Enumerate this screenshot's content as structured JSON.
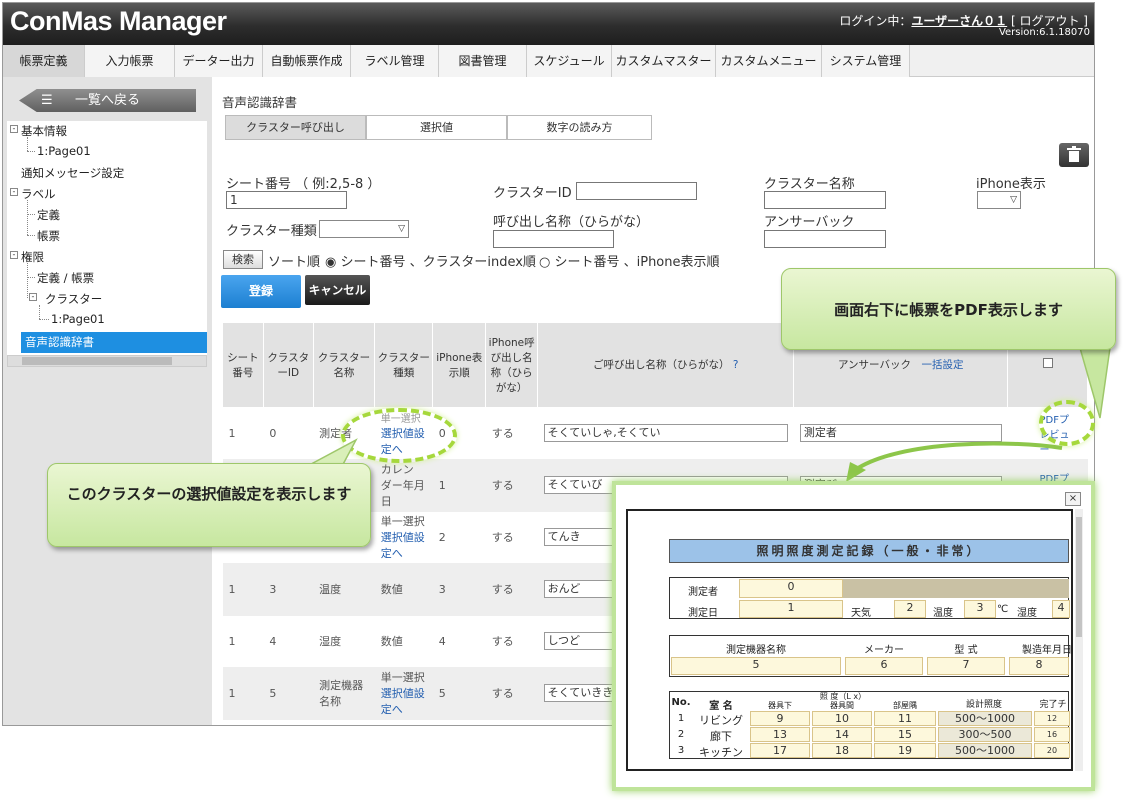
{
  "header": {
    "logo": "ConMas Manager",
    "login_label": "ログイン中：",
    "user": "ユーザーさん０１",
    "logout": "[ ログアウト ]",
    "version": "Version:6.1.18070"
  },
  "nav": {
    "items": [
      "帳票定義",
      "入力帳票",
      "データー出力",
      "自動帳票作成",
      "ラベル管理",
      "図書管理",
      "スケジュール",
      "カスタムマスター",
      "カスタムメニュー",
      "システム管理"
    ]
  },
  "sidebar": {
    "back_label": "一覧へ戻る",
    "tree": [
      "基本情報",
      "1:Page01",
      "通知メッセージ設定",
      "ラベル",
      "定義",
      "帳票",
      "権限",
      "定義 / 帳票",
      "クラスター",
      "1:Page01",
      "音声認識辞書"
    ]
  },
  "main": {
    "title": "音声認識辞書",
    "tabs": [
      "クラスター呼び出し",
      "選択値",
      "数字の読み方"
    ],
    "form": {
      "sheet_label": "シート番号 （ 例:2,5-8 ）",
      "sheet_value": "1",
      "cluster_id_label": "クラスターID",
      "cluster_name_label": "クラスター名称",
      "iphone_label": "iPhone表示",
      "cluster_type_label": "クラスター種類",
      "reading_label": "呼び出し名称（ひらがな）",
      "answer_label": "アンサーバック",
      "search_button": "検索",
      "sort_label": "ソート順",
      "sort_opt1": "シート番号 、クラスターindex順",
      "sort_opt2": "シート番号 、iPhone表示順",
      "register_button": "登録",
      "cancel_button": "キャンセル"
    },
    "table": {
      "headers": [
        "シート番号",
        "クラスターID",
        "クラスター名称",
        "クラスター種類",
        "iPhone表示順",
        "iPhone呼び出し名称（ひらがな）",
        "ご呼び出し名称（ひらがな）",
        "アンサーバック"
      ],
      "help": "?",
      "batch": "一括設定",
      "rows": [
        {
          "sheet": "1",
          "id": "0",
          "name": "測定者",
          "type1": "単一選択",
          "type2": "選択値設定へ",
          "order": "0",
          "yomi": "する",
          "reading": "そくていしゃ,そくてい",
          "answer": "測定者",
          "pdf": "PDFプレビュー"
        },
        {
          "sheet": "",
          "id": "",
          "name": "",
          "type1": "カレン",
          "type2": "ダー年月日",
          "order": "1",
          "yomi": "する",
          "reading": "そくていび",
          "answer": "測定び",
          "pdf": "PDFプレ"
        },
        {
          "sheet": "",
          "id": "",
          "name": "",
          "type1": "単一選択",
          "type2": "選択値設定へ",
          "order": "2",
          "yomi": "する",
          "reading": "てんき",
          "answer": "",
          "pdf": ""
        },
        {
          "sheet": "1",
          "id": "3",
          "name": "温度",
          "type1": "数値",
          "type2": "",
          "order": "3",
          "yomi": "する",
          "reading": "おんど",
          "answer": "",
          "pdf": ""
        },
        {
          "sheet": "1",
          "id": "4",
          "name": "湿度",
          "type1": "数値",
          "type2": "",
          "order": "4",
          "yomi": "する",
          "reading": "しつど",
          "answer": "",
          "pdf": ""
        },
        {
          "sheet": "1",
          "id": "5",
          "name": "測定機器名称",
          "type1": "単一選択",
          "type2": "選択値設定へ",
          "order": "5",
          "yomi": "する",
          "reading": "そくていきき",
          "answer": "",
          "pdf": ""
        }
      ]
    }
  },
  "callouts": {
    "pdf": "画面右下に帳票をPDF表示します",
    "select": "このクラスターの選択値設定を表示します"
  },
  "popup": {
    "close": "×",
    "report": {
      "title": "照明照度測定記録（一般・非常）",
      "measurer_label": "測定者",
      "measurer_value": "0",
      "date_label": "測定日",
      "date_value": "1",
      "weather_label": "天気",
      "weather_value": "2",
      "temp_label": "温度",
      "temp_value": "3",
      "temp_unit": "℃",
      "humid_label": "湿度",
      "humid_value": "4",
      "device_label": "測定機器名称",
      "maker_label": "メーカー",
      "model_label": "型 式",
      "mfg_label": "製造年月日",
      "device_value": "5",
      "maker_value": "6",
      "model_value": "7",
      "mfg_value": "8",
      "col_no": "No.",
      "col_room": "室 名",
      "col_lux": "照 度（L x）",
      "col_lux1": "器具下",
      "col_lux2": "器具間",
      "col_lux3": "部屋隅",
      "col_design": "設計照度",
      "col_done": "完了チ",
      "rows": [
        {
          "no": "1",
          "room": "リビング",
          "a": "9",
          "b": "10",
          "c": "11",
          "design": "500～1000",
          "done": "12"
        },
        {
          "no": "2",
          "room": "廊下",
          "a": "13",
          "b": "14",
          "c": "15",
          "design": "300～500",
          "done": "16"
        },
        {
          "no": "3",
          "room": "キッチン",
          "a": "17",
          "b": "18",
          "c": "19",
          "design": "500～1000",
          "done": "20"
        }
      ]
    }
  },
  "colors": {
    "accent": "#1e8fe1",
    "header": "#2d2d2d",
    "bubble": "#c7e7a0",
    "highlight": "#a6d83c"
  }
}
